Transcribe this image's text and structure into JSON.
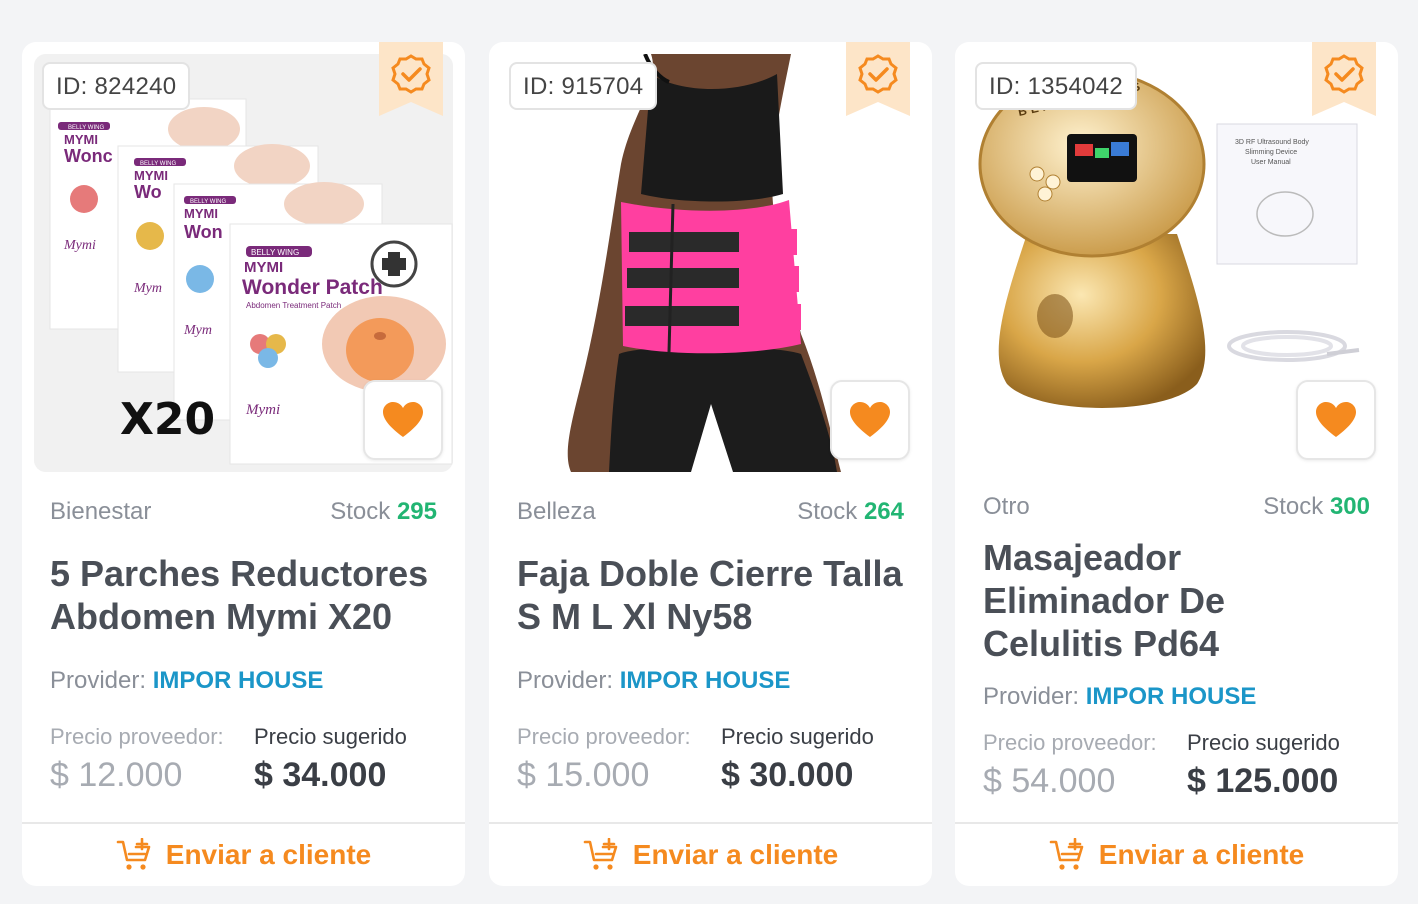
{
  "colors": {
    "accent": "#f58a1f",
    "stock": "#22b573",
    "provider": "#1b96c8",
    "ribbon": "#fde5c8"
  },
  "icons": {
    "verified": "verified-badge-icon",
    "favorite": "heart-icon",
    "send": "cart-plus-icon"
  },
  "labels": {
    "stock": "Stock",
    "provider": "Provider:",
    "price_provider": "Precio proveedor:",
    "price_suggested": "Precio sugerido",
    "send": "Enviar a cliente"
  },
  "products": [
    {
      "id_label": "ID: 824240",
      "category": "Bienestar",
      "stock": "295",
      "title": "5 Parches Reductores Abdomen Mymi X20",
      "provider": "IMPOR HOUSE",
      "price_provider": "$ 12.000",
      "price_suggested": "$ 34.000",
      "image_text": {
        "brand": "BELLY WING",
        "product_line": "MYMI",
        "product_name": "Wonder Patch",
        "subtitle": "Abdomen Treatment Patch",
        "logo": "Mymi",
        "quantity": "X20"
      }
    },
    {
      "id_label": "ID: 915704",
      "category": "Belleza",
      "stock": "264",
      "title": "Faja Doble Cierre Talla S M L Xl Ny58",
      "provider": "IMPOR HOUSE",
      "price_provider": "$ 15.000",
      "price_suggested": "$ 30.000"
    },
    {
      "id_label": "ID: 1354042",
      "category": "Otro",
      "stock": "300",
      "title": "Masajeador Eliminador De Celulitis Pd64",
      "provider": "IMPOR HOUSE",
      "price_provider": "$ 54.000",
      "price_suggested": "$ 125.000",
      "image_text": {
        "device_brand": "BEAUTY PLUS",
        "manual_title": "3D RF Ultrasound Body Slimming Device User Manual"
      }
    }
  ]
}
